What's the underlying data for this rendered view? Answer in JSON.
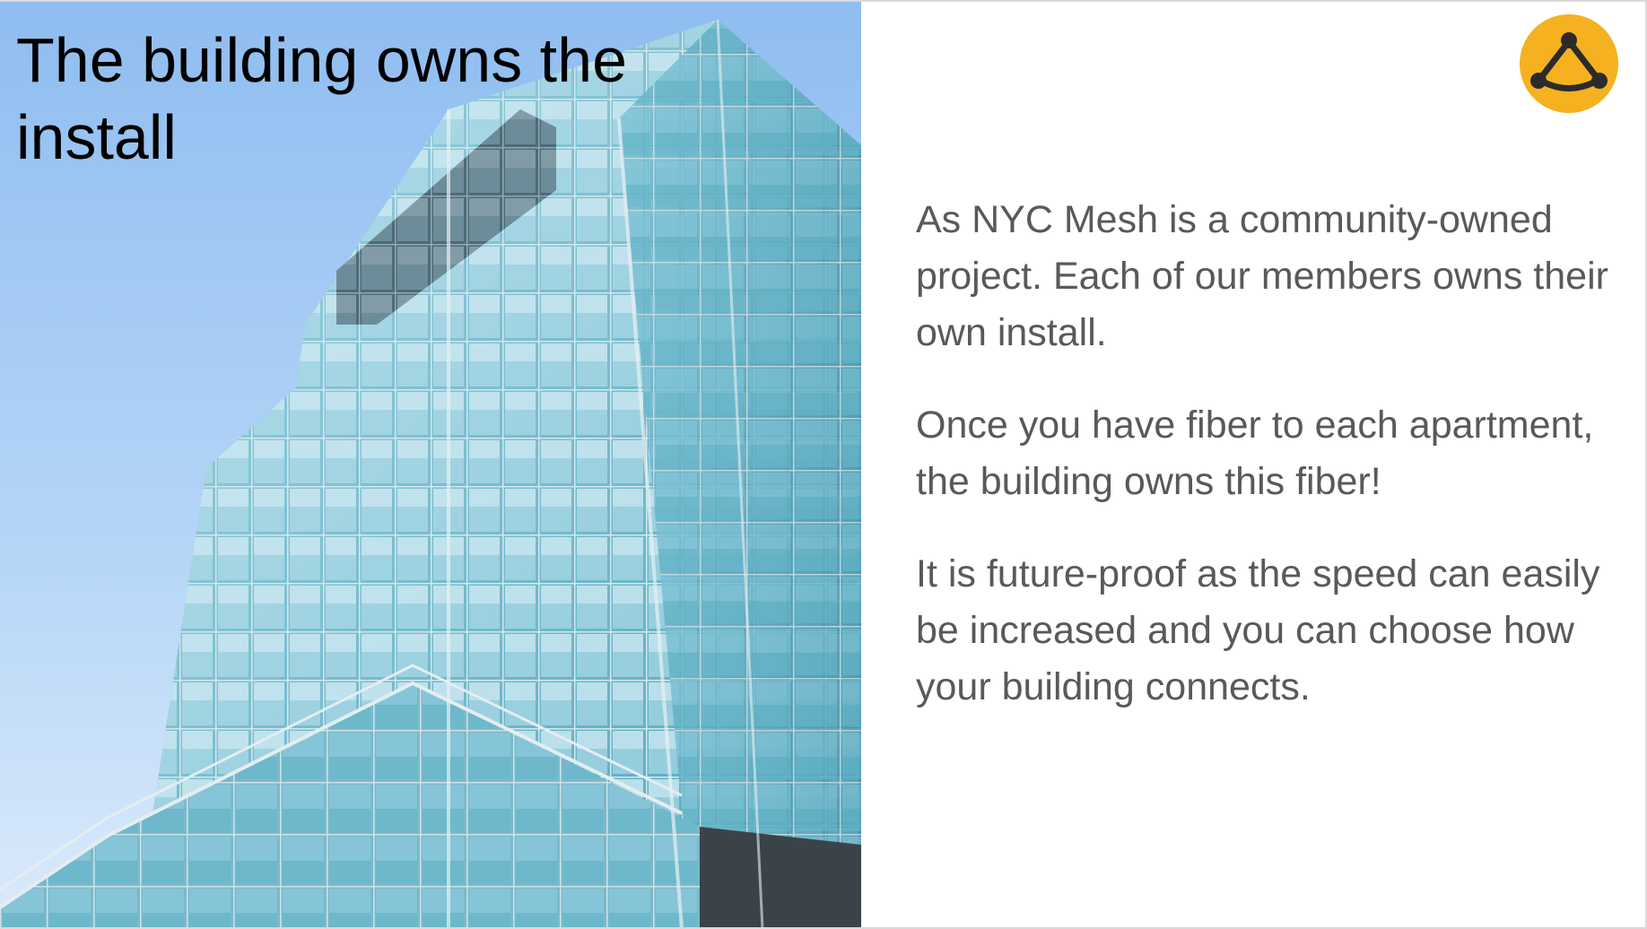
{
  "slide": {
    "title": "The building owns the install",
    "paragraphs": [
      "As NYC Mesh is a community-owned project. Each of our members owns their own install.",
      "Once you have fiber to each apartment, the building owns this fiber!",
      "It is future-proof as the speed can easily be increased and you can choose how your building connects."
    ]
  },
  "logo": {
    "icon": "nyc-mesh-logo-icon",
    "color": "#f5b120"
  },
  "image": {
    "icon": "glass-building-photo",
    "sky_color": "#a9cdf5",
    "glass_color": "#7fc4d4"
  },
  "colors": {
    "title": "#000000",
    "body": "#595959",
    "background": "#ffffff"
  }
}
